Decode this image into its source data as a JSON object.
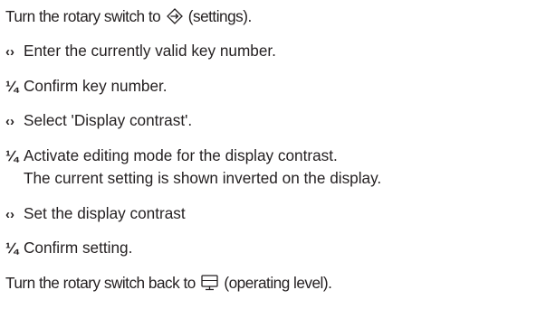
{
  "steps": [
    {
      "type": "text",
      "before": "Turn the rotary switch to",
      "icon": "settings-icon",
      "after": "(settings)."
    },
    {
      "type": "step",
      "symbol": "‹›",
      "symbol_kind": "rotate",
      "text": "Enter the currently valid key number."
    },
    {
      "type": "step",
      "symbol": "¼",
      "symbol_kind": "press",
      "text": "Confirm key number."
    },
    {
      "type": "step",
      "symbol": "‹›",
      "symbol_kind": "rotate",
      "text": "Select 'Display contrast'."
    },
    {
      "type": "step",
      "symbol": "¼",
      "symbol_kind": "press",
      "text": "Activate editing mode for the display contrast.",
      "continuation": "The current setting is shown inverted on the display."
    },
    {
      "type": "step",
      "symbol": "‹›",
      "symbol_kind": "rotate",
      "text": "Set the display contrast"
    },
    {
      "type": "step",
      "symbol": "¼",
      "symbol_kind": "press",
      "text": "Confirm setting."
    },
    {
      "type": "text",
      "before": "Turn the rotary switch back to",
      "icon": "operating-level-icon",
      "after": "(operating level)."
    }
  ]
}
